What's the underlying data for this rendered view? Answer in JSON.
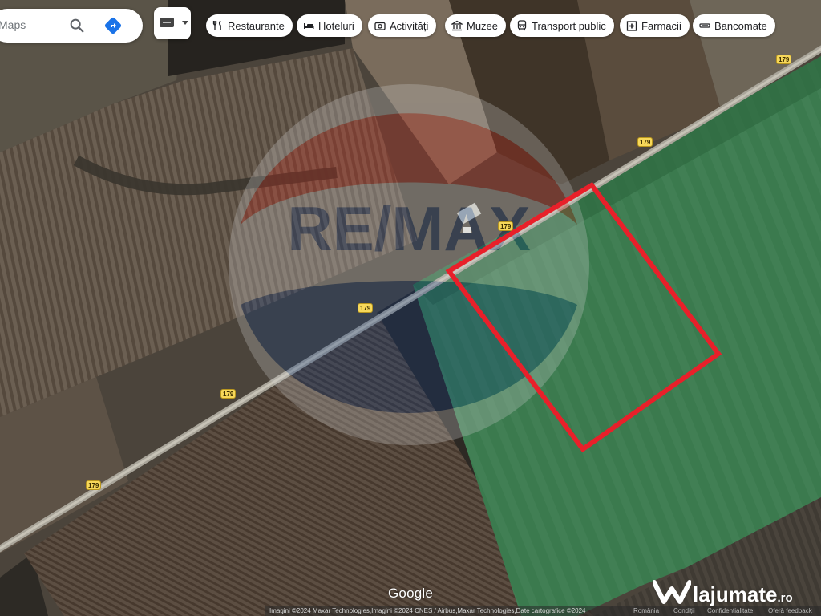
{
  "search": {
    "text": "Maps"
  },
  "chips": [
    {
      "label": "Restaurante",
      "icon": "fork-knife-icon"
    },
    {
      "label": "Hoteluri",
      "icon": "bed-icon"
    },
    {
      "label": "Activități",
      "icon": "camera-icon"
    },
    {
      "label": "Muzee",
      "icon": "museum-icon"
    },
    {
      "label": "Transport public",
      "icon": "transit-icon"
    },
    {
      "label": "Farmacii",
      "icon": "pharmacy-icon"
    },
    {
      "label": "Bancomate",
      "icon": "atm-icon"
    }
  ],
  "road_label": "179",
  "map": {
    "google_logo": "Google",
    "attribution": "Imagini ©2024 Maxar Technologies,Imagini ©2024 CNES / Airbus,Maxar Technologies,Date cartografice ©2024",
    "footer_links": [
      "România",
      "Condiții",
      "Confidențialitate",
      "Oferă feedback"
    ],
    "watermark_logo_text": "RE/MAX",
    "colors": {
      "property_outline": "#e8202a",
      "road_badge": "#f7d85a"
    }
  },
  "brand": {
    "name": "lajumate",
    "tld": ".ro"
  }
}
